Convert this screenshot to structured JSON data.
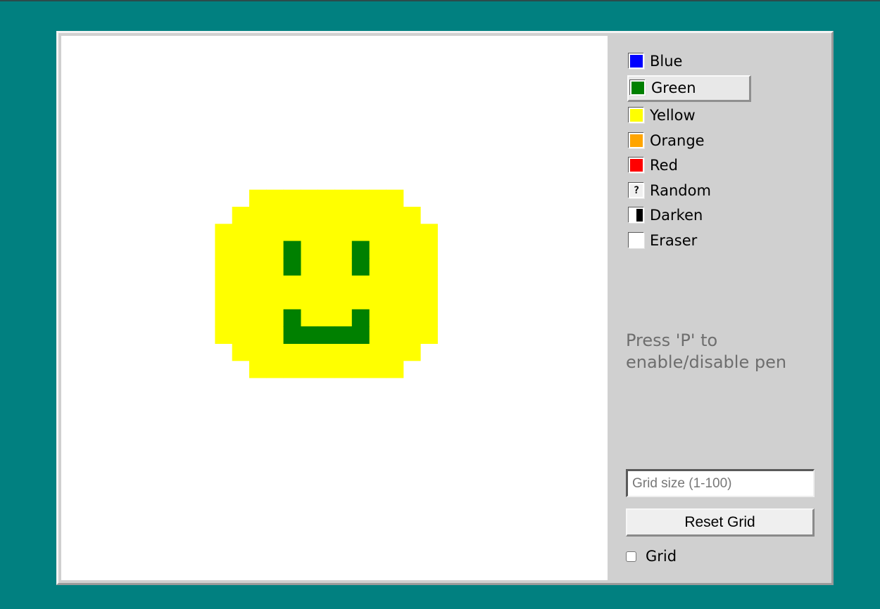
{
  "colors": [
    {
      "label": "Blue",
      "swatch": "#0000ff",
      "icon": "blue-swatch-icon"
    },
    {
      "label": "Green",
      "swatch": "#008000",
      "icon": "green-swatch-icon",
      "selected": true
    },
    {
      "label": "Yellow",
      "swatch": "#ffff00",
      "icon": "yellow-swatch-icon"
    },
    {
      "label": "Orange",
      "swatch": "#ffa500",
      "icon": "orange-swatch-icon"
    },
    {
      "label": "Red",
      "swatch": "#ff0000",
      "icon": "red-swatch-icon"
    },
    {
      "label": "Random",
      "swatch_glyph": "?",
      "icon": "question-mark-icon"
    },
    {
      "label": "Darken",
      "icon": "half-black-white-icon"
    },
    {
      "label": "Eraser",
      "swatch": "#ffffff",
      "icon": "blank-swatch-icon"
    }
  ],
  "hint": "Press 'P' to enable/disable pen",
  "grid_input": {
    "placeholder": "Grid size (1-100)",
    "value": ""
  },
  "reset_label": "Reset Grid",
  "grid_toggle": {
    "label": "Grid",
    "checked": false
  },
  "canvas": {
    "background": "#ffffff",
    "drawing": {
      "face_color": "#ffff00",
      "feature_color": "#008000",
      "face_rows_cols": [
        [
          9,
          10,
          19
        ],
        [
          10,
          9,
          20
        ],
        [
          11,
          8,
          21
        ],
        [
          12,
          8,
          21
        ],
        [
          13,
          8,
          21
        ],
        [
          14,
          8,
          21
        ],
        [
          15,
          8,
          21
        ],
        [
          16,
          8,
          21
        ],
        [
          17,
          8,
          21
        ],
        [
          18,
          9,
          20
        ],
        [
          19,
          10,
          19
        ]
      ],
      "feature_cells": [
        [
          12,
          12
        ],
        [
          12,
          16
        ],
        [
          13,
          12
        ],
        [
          13,
          16
        ],
        [
          16,
          12
        ],
        [
          16,
          16
        ],
        [
          17,
          12
        ],
        [
          17,
          13
        ],
        [
          17,
          14
        ],
        [
          17,
          15
        ],
        [
          17,
          16
        ]
      ]
    }
  }
}
